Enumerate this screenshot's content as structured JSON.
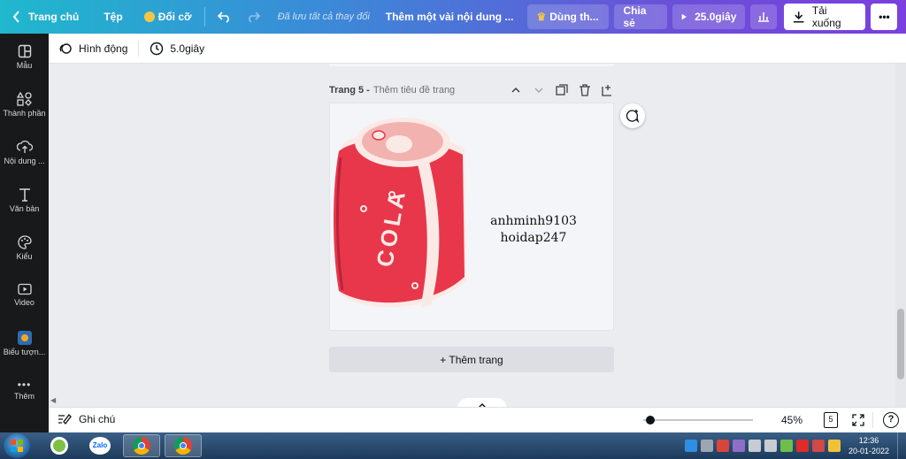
{
  "topbar": {
    "back_label": "Trang chủ",
    "file_label": "Tệp",
    "resize_label": "Đổi cỡ",
    "saved_status": "Đã lưu tất cả thay đổi",
    "doc_title": "Thêm một vài nội dung ...",
    "try_pro_label": "Dùng th...",
    "share_label": "Chia sẻ",
    "play_label": "25.0giây",
    "download_label": "Tải xuống"
  },
  "sidebar": {
    "items": [
      {
        "label": "Mẫu",
        "icon": "template-icon"
      },
      {
        "label": "Thành phần",
        "icon": "elements-icon"
      },
      {
        "label": "Nội dung ...",
        "icon": "upload-icon"
      },
      {
        "label": "Văn bản",
        "icon": "text-icon"
      },
      {
        "label": "Kiểu",
        "icon": "palette-icon"
      },
      {
        "label": "Video",
        "icon": "video-icon"
      },
      {
        "label": "Biểu tượn...",
        "icon": "logo-icon"
      },
      {
        "label": "Thêm",
        "icon": "more-icon"
      }
    ]
  },
  "subbar": {
    "animate_label": "Hình động",
    "duration_label": "5.0giây"
  },
  "page": {
    "page_label": "Trang 5 -",
    "page_title_placeholder": "Thêm tiêu đề trang",
    "text_line1": "anhminh9103",
    "text_line2": "hoidap247",
    "can_text": "COLA",
    "add_page_label": "+ Thêm trang"
  },
  "bottombar": {
    "notes_label": "Ghi chú",
    "zoom_value": "45%",
    "page_count": "5"
  },
  "taskbar": {
    "time": "12:36",
    "date": "20-01-2022",
    "zalo_label": "Zalo"
  },
  "colors": {
    "accent_gradient_start": "#1fb8cd",
    "accent_gradient_end": "#7b3fe0",
    "can_red": "#e8374a",
    "can_pink": "#f2b3b0"
  }
}
